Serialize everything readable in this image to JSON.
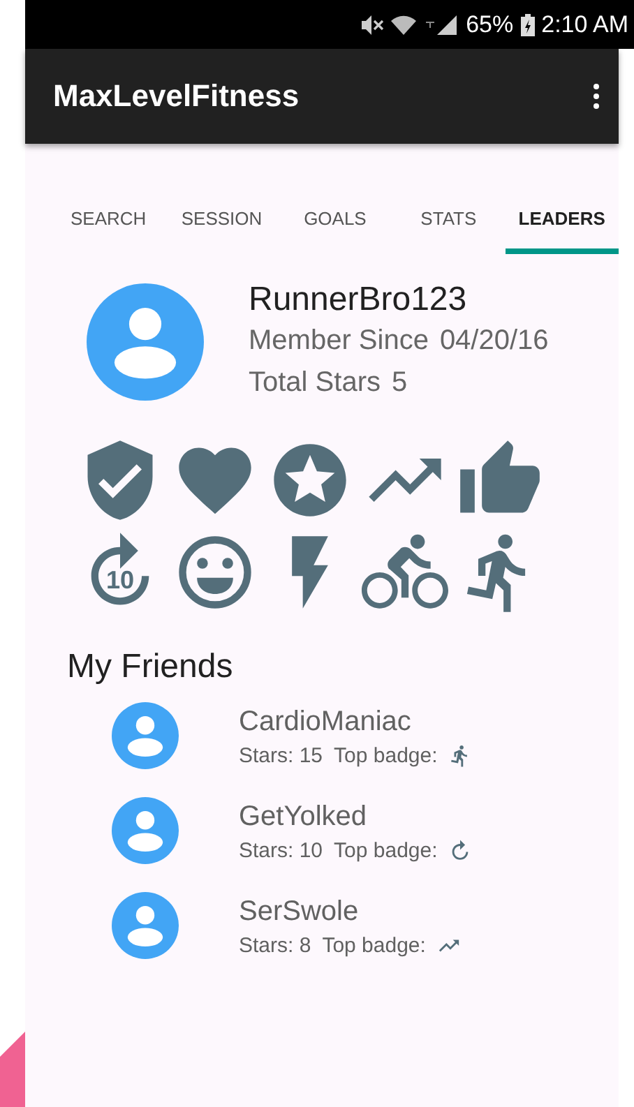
{
  "status_bar": {
    "battery": "65%",
    "time": "2:10 AM"
  },
  "app_bar": {
    "title": "MaxLevelFitness"
  },
  "tabs": [
    {
      "label": "SEARCH",
      "selected": false
    },
    {
      "label": "SESSION",
      "selected": false
    },
    {
      "label": "GOALS",
      "selected": false
    },
    {
      "label": "STATS",
      "selected": false
    },
    {
      "label": "LEADERS",
      "selected": true
    }
  ],
  "profile": {
    "name": "RunnerBro123",
    "member_since_label": "Member Since",
    "member_since": "04/20/16",
    "total_stars_label": "Total Stars",
    "total_stars": "5"
  },
  "badges": [
    {
      "kind": "shield"
    },
    {
      "kind": "heart"
    },
    {
      "kind": "star"
    },
    {
      "kind": "trend"
    },
    {
      "kind": "thumb"
    },
    {
      "kind": "replay",
      "label": "10"
    },
    {
      "kind": "smiley"
    },
    {
      "kind": "bolt"
    },
    {
      "kind": "bike"
    },
    {
      "kind": "run"
    }
  ],
  "friends_heading": "My Friends",
  "friends": [
    {
      "name": "CardioManiac",
      "stars": "Stars: 15",
      "top_badge_label": "Top badge:",
      "top_badge": {
        "kind": "run"
      }
    },
    {
      "name": "GetYolked",
      "stars": "Stars: 10",
      "top_badge_label": "Top badge:",
      "top_badge": {
        "kind": "replay"
      }
    },
    {
      "name": "SerSwole",
      "stars": "Stars: 8",
      "top_badge_label": "Top badge:",
      "top_badge": {
        "kind": "trend"
      }
    }
  ]
}
